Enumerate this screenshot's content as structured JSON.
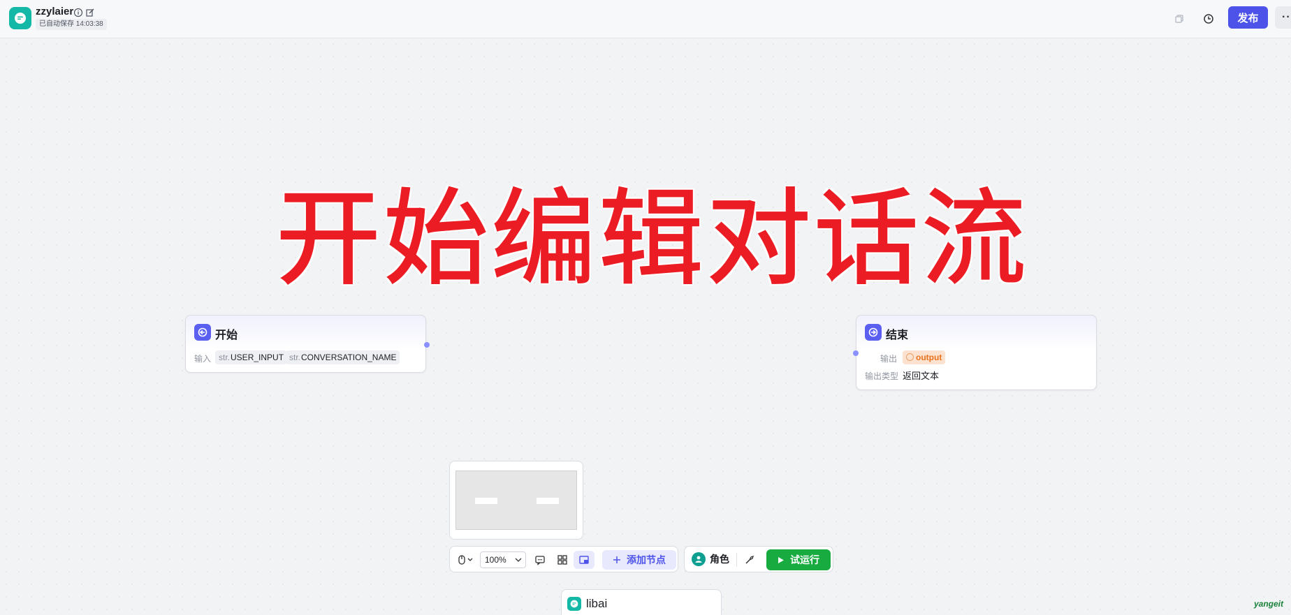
{
  "header": {
    "app_name": "zzylaier",
    "save_status": "已自动保存 14:03:38",
    "publish_label": "发布",
    "more_label": "···"
  },
  "overlay": {
    "title": "开始编辑对话流"
  },
  "start_node": {
    "title": "开始",
    "input_label": "输入",
    "inputs": [
      {
        "type": "str.",
        "name": "USER_INPUT"
      },
      {
        "type": "str.",
        "name": "CONVERSATION_NAME"
      }
    ]
  },
  "end_node": {
    "title": "结束",
    "output_label": "输出",
    "output_value": "output",
    "output_type_label": "输出类型",
    "output_type_value": "返回文本"
  },
  "toolbar": {
    "zoom": "100%",
    "add_node_label": "添加节点",
    "role_label": "角色",
    "run_label": "试运行"
  },
  "bot": {
    "name": "libai"
  },
  "watermark": "yangeit",
  "colors": {
    "primary": "#4d53e8",
    "run_green": "#17ab40",
    "logo_teal": "#14b8a6",
    "overlay_red": "#ec1c24"
  }
}
